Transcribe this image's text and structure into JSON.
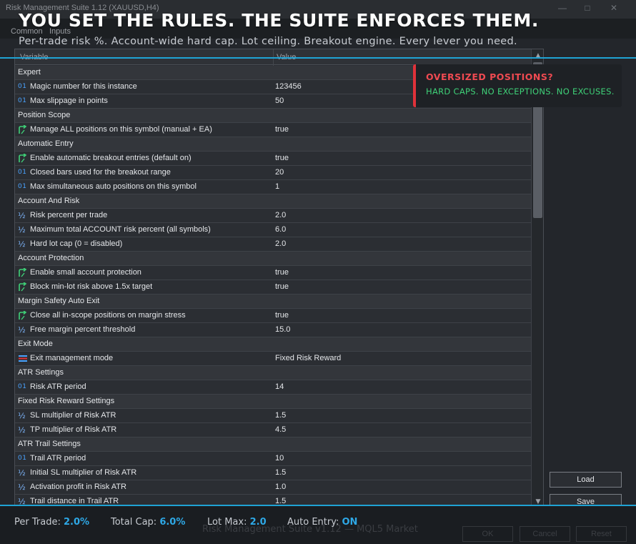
{
  "window": {
    "title": "Risk Management Suite 1.12 (XAUUSD,H4)",
    "min_glyph": "—",
    "max_glyph": "□",
    "close_glyph": "✕"
  },
  "tabs": [
    "Common",
    "Inputs"
  ],
  "headline": "YOU SET THE RULES. THE SUITE ENFORCES THEM.",
  "subline": "Per-trade risk %. Account-wide hard cap. Lot ceiling. Breakout engine. Every lever you need.",
  "grid": {
    "col_variable": "Variable",
    "col_value": "Value",
    "rows": [
      {
        "kind": "group",
        "name": "Expert"
      },
      {
        "kind": "param",
        "type": "int",
        "name": "Magic number for this instance",
        "value": "123456"
      },
      {
        "kind": "param",
        "type": "int",
        "name": "Max slippage in points",
        "value": "50"
      },
      {
        "kind": "group",
        "name": "Position Scope"
      },
      {
        "kind": "param",
        "type": "bool",
        "name": "Manage ALL positions on this symbol (manual + EA)",
        "value": "true"
      },
      {
        "kind": "group",
        "name": "Automatic Entry"
      },
      {
        "kind": "param",
        "type": "bool",
        "name": "Enable automatic breakout entries (default on)",
        "value": "true"
      },
      {
        "kind": "param",
        "type": "int",
        "name": "Closed bars used for the breakout range",
        "value": "20"
      },
      {
        "kind": "param",
        "type": "int",
        "name": "Max simultaneous auto positions on this symbol",
        "value": "1"
      },
      {
        "kind": "group",
        "name": "Account And Risk"
      },
      {
        "kind": "param",
        "type": "double",
        "name": "Risk percent per trade",
        "value": "2.0"
      },
      {
        "kind": "param",
        "type": "double",
        "name": "Maximum total ACCOUNT risk percent (all symbols)",
        "value": "6.0"
      },
      {
        "kind": "param",
        "type": "double",
        "name": "Hard lot cap (0 = disabled)",
        "value": "2.0"
      },
      {
        "kind": "group",
        "name": "Account Protection"
      },
      {
        "kind": "param",
        "type": "bool",
        "name": "Enable small account protection",
        "value": "true"
      },
      {
        "kind": "param",
        "type": "bool",
        "name": "Block min-lot risk above 1.5x target",
        "value": "true"
      },
      {
        "kind": "group",
        "name": "Margin Safety Auto Exit"
      },
      {
        "kind": "param",
        "type": "bool",
        "name": "Close all in-scope positions on margin stress",
        "value": "true"
      },
      {
        "kind": "param",
        "type": "double",
        "name": "Free margin percent threshold",
        "value": "15.0"
      },
      {
        "kind": "group",
        "name": "Exit Mode"
      },
      {
        "kind": "param",
        "type": "enum",
        "name": "Exit management mode",
        "value": "Fixed Risk Reward"
      },
      {
        "kind": "group",
        "name": "ATR Settings"
      },
      {
        "kind": "param",
        "type": "int",
        "name": "Risk ATR period",
        "value": "14"
      },
      {
        "kind": "group",
        "name": "Fixed Risk Reward Settings"
      },
      {
        "kind": "param",
        "type": "double",
        "name": "SL multiplier of Risk ATR",
        "value": "1.5"
      },
      {
        "kind": "param",
        "type": "double",
        "name": "TP multiplier of Risk ATR",
        "value": "4.5"
      },
      {
        "kind": "group",
        "name": "ATR Trail Settings"
      },
      {
        "kind": "param",
        "type": "int",
        "name": "Trail ATR period",
        "value": "10"
      },
      {
        "kind": "param",
        "type": "double",
        "name": "Initial SL multiplier of Risk ATR",
        "value": "1.5"
      },
      {
        "kind": "param",
        "type": "double",
        "name": "Activation profit in Risk ATR",
        "value": "1.0"
      },
      {
        "kind": "param",
        "type": "double",
        "name": "Trail distance in Trail ATR",
        "value": "1.5"
      }
    ]
  },
  "icons": {
    "int": "01",
    "double": "½",
    "bool": "bool-arrow-icon",
    "enum": "enum-list-icon"
  },
  "callout": {
    "title": "OVERSIZED POSITIONS?",
    "body": "HARD CAPS. NO EXCEPTIONS. NO EXCUSES."
  },
  "buttons": {
    "load": "Load",
    "save": "Save",
    "ok": "OK",
    "cancel": "Cancel",
    "reset": "Reset"
  },
  "stats": {
    "per_trade_label": "Per Trade:",
    "per_trade_value": "2.0%",
    "total_cap_label": "Total Cap:",
    "total_cap_value": "6.0%",
    "lot_max_label": "Lot Max:",
    "lot_max_value": "2.0",
    "auto_entry_label": "Auto Entry:",
    "auto_entry_value": "ON"
  },
  "footer": "Risk Management Suite v1.12 — MQL5 Market",
  "colors": {
    "accent": "#1fa3d4",
    "alert_red": "#e0323a",
    "ok_green": "#3fd178",
    "stat_blue": "#2ea8e6"
  }
}
